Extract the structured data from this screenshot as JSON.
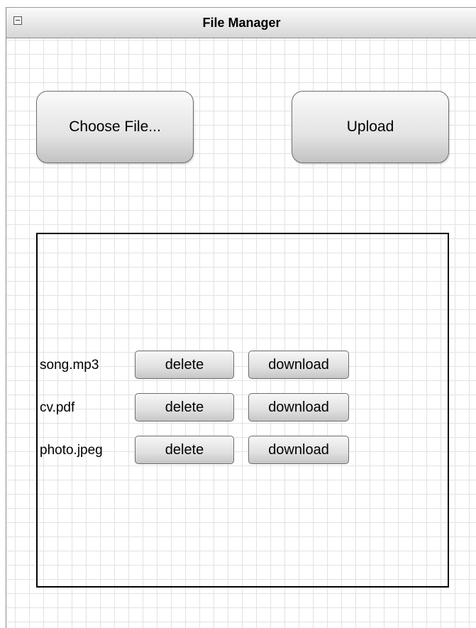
{
  "window": {
    "title": "File Manager"
  },
  "toolbar": {
    "choose_label": "Choose File...",
    "upload_label": "Upload"
  },
  "files": [
    {
      "name": "song.mp3",
      "delete_label": "delete",
      "download_label": "download"
    },
    {
      "name": "cv.pdf",
      "delete_label": "delete",
      "download_label": "download"
    },
    {
      "name": "photo.jpeg",
      "delete_label": "delete",
      "download_label": "download"
    }
  ],
  "icons": {
    "collapse": "minus-square-icon"
  }
}
